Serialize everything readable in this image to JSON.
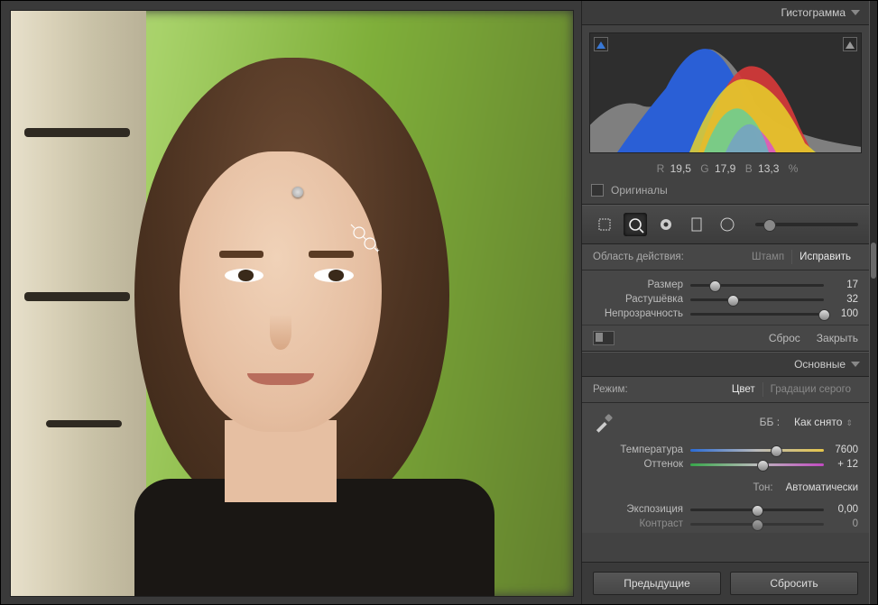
{
  "histogram": {
    "title": "Гистограмма",
    "readout": {
      "r_label": "R",
      "r": "19,5",
      "g_label": "G",
      "g": "17,9",
      "b_label": "B",
      "b": "13,3",
      "pct": "%"
    },
    "originals_label": "Оригиналы"
  },
  "tools": {
    "crop": "crop-icon",
    "spot": "spot-icon",
    "redeye": "redeye-icon",
    "grad": "gradient-icon",
    "radial": "radial-icon",
    "brush": "brush-icon"
  },
  "spot_panel": {
    "area_label": "Область действия:",
    "mode_clone": "Штамп",
    "mode_heal": "Исправить",
    "sliders_label": {
      "size": "Размер",
      "feather": "Растушёвка",
      "opacity": "Непрозрачность"
    },
    "values": {
      "size": "17",
      "feather": "32",
      "opacity": "100"
    },
    "knob_pct": {
      "size": 18,
      "feather": 32,
      "opacity": 100
    },
    "reset": "Сброс",
    "close": "Закрыть"
  },
  "basic_panel": {
    "title": "Основные",
    "treatment_label": "Режим:",
    "treatment_color": "Цвет",
    "treatment_bw": "Градации серого",
    "wb_label": "ББ :",
    "wb_value": "Как снято",
    "temp_label": "Температура",
    "temp_value": "7600",
    "temp_knob": 64,
    "tint_label": "Оттенок",
    "tint_value": "+ 12",
    "tint_knob": 54,
    "tone_label": "Тон:",
    "auto_label": "Автоматически",
    "exposure_label": "Экспозиция",
    "exposure_value": "0,00",
    "exposure_knob": 50,
    "contrast_label": "Контраст",
    "contrast_value": "0",
    "contrast_knob": 50
  },
  "footer": {
    "prev": "Предыдущие",
    "reset": "Сбросить"
  }
}
